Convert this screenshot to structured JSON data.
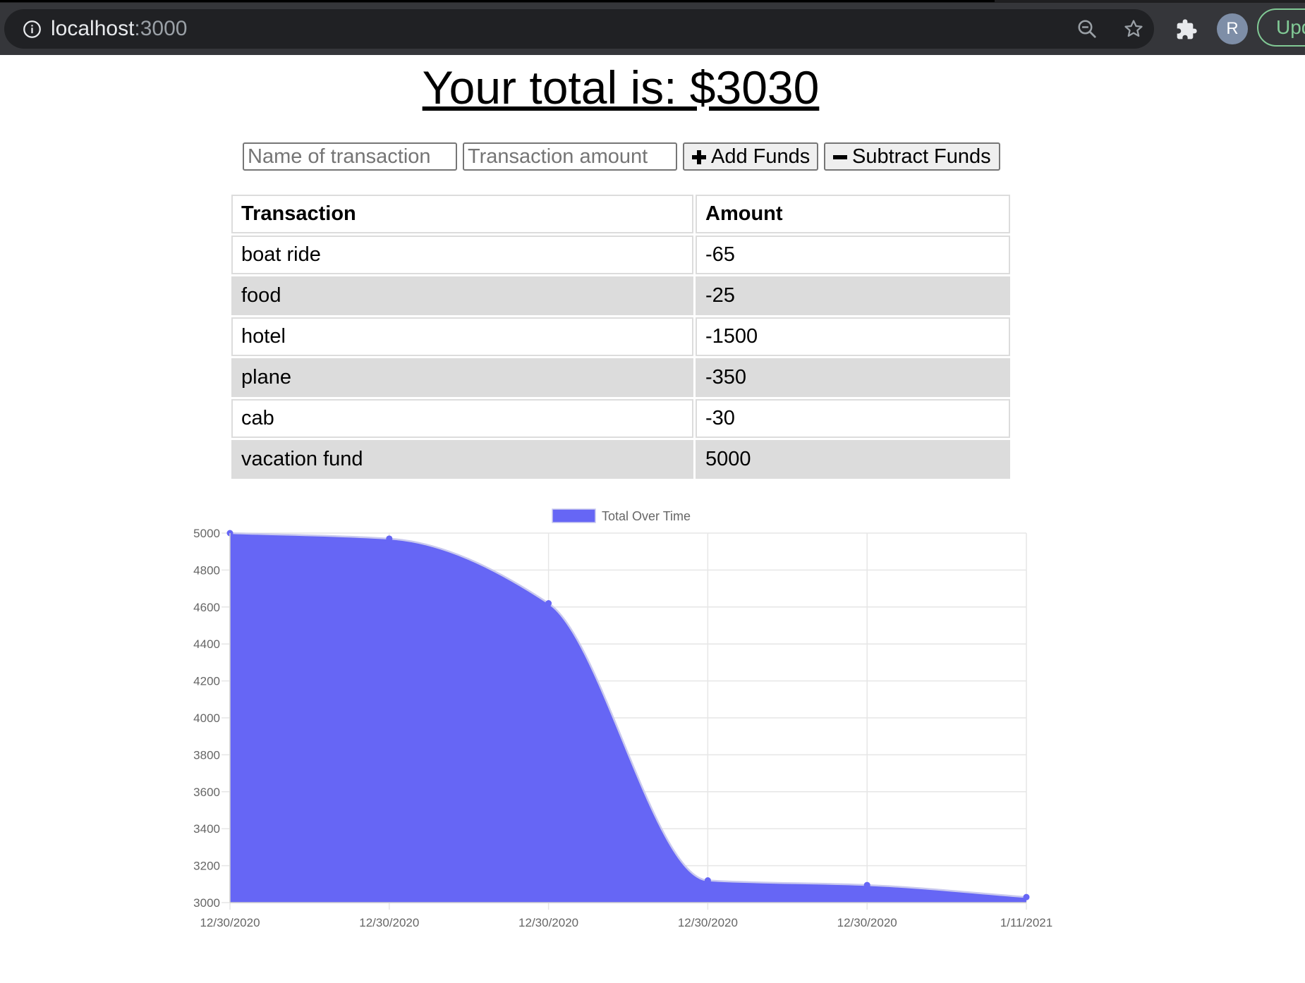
{
  "browser": {
    "url_host": "localhost",
    "url_port": ":3000",
    "avatar_initial": "R",
    "update_label": "Update"
  },
  "page": {
    "title": "Your total is: $3030"
  },
  "form": {
    "name_placeholder": "Name of transaction",
    "amount_placeholder": "Transaction amount",
    "add_label": "Add Funds",
    "subtract_label": "Subtract Funds"
  },
  "table": {
    "headers": [
      "Transaction",
      "Amount"
    ],
    "rows": [
      [
        "boat ride",
        "-65"
      ],
      [
        "food",
        "-25"
      ],
      [
        "hotel",
        "-1500"
      ],
      [
        "plane",
        "-350"
      ],
      [
        "cab",
        "-30"
      ],
      [
        "vacation fund",
        "5000"
      ]
    ]
  },
  "chart_data": {
    "type": "area",
    "x": [
      "12/30/2020",
      "12/30/2020",
      "12/30/2020",
      "12/30/2020",
      "12/30/2020",
      "1/11/2021"
    ],
    "series": [
      {
        "name": "Total Over Time",
        "values": [
          5000,
          4970,
          4620,
          3120,
          3095,
          3030
        ],
        "color": "#6666f5"
      }
    ],
    "ylim": [
      3000,
      5000
    ],
    "yticks": [
      5000,
      4800,
      4600,
      4400,
      4200,
      4000,
      3800,
      3600,
      3400,
      3200,
      3000
    ],
    "grid": true,
    "legend_position": "top-center",
    "title": "",
    "xlabel": "",
    "ylabel": ""
  }
}
